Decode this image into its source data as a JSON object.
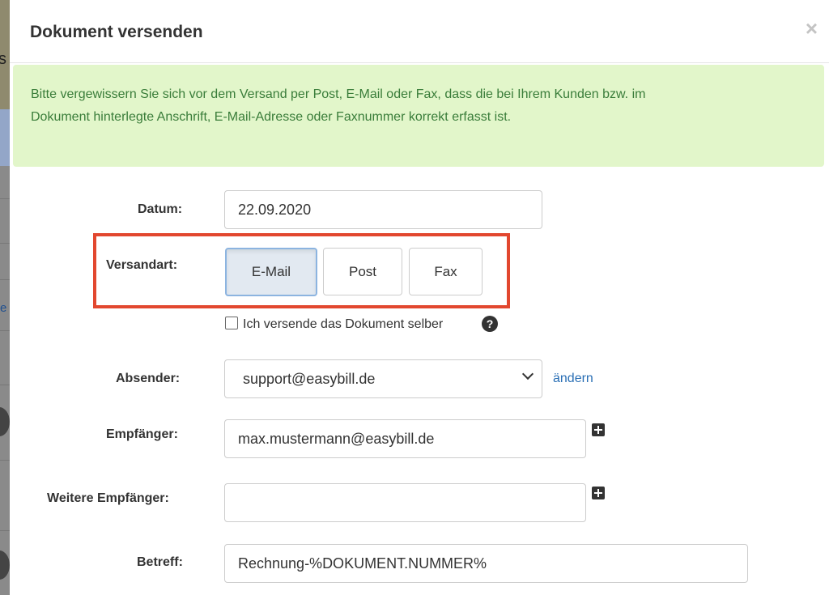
{
  "bg": {
    "char": "s",
    "char2": "e"
  },
  "modal": {
    "title": "Dokument versenden",
    "close_icon": "×"
  },
  "alert": {
    "text": "Bitte vergewissern Sie sich vor dem Versand per Post, E-Mail oder Fax, dass die bei Ihrem Kunden bzw. im Dokument hinterlegte Anschrift, E-Mail-Adresse oder Faxnummer korrekt erfasst ist."
  },
  "form": {
    "datum": {
      "label": "Datum:",
      "value": "22.09.2020"
    },
    "versandart": {
      "label": "Versandart:",
      "options": [
        "E-Mail",
        "Post",
        "Fax"
      ],
      "selected": "E-Mail"
    },
    "self_send": {
      "label": "Ich versende das Dokument selber",
      "checked": false,
      "help_icon": "?"
    },
    "absender": {
      "label": "Absender:",
      "value": "support@easybill.de",
      "change_link": "ändern"
    },
    "empfaenger": {
      "label": "Empfänger:",
      "value": "max.mustermann@easybill.de"
    },
    "weitere": {
      "label": "Weitere Empfänger:",
      "value": ""
    },
    "betreff": {
      "label": "Betreff:",
      "value": "Rechnung-%DOKUMENT.NUMMER%"
    }
  },
  "colors": {
    "alert_bg": "#e2f6ca",
    "alert_text": "#3a7d3a",
    "highlight": "#e2472f",
    "link": "#2a6fb5",
    "active_btn": "#e2e9f1"
  }
}
